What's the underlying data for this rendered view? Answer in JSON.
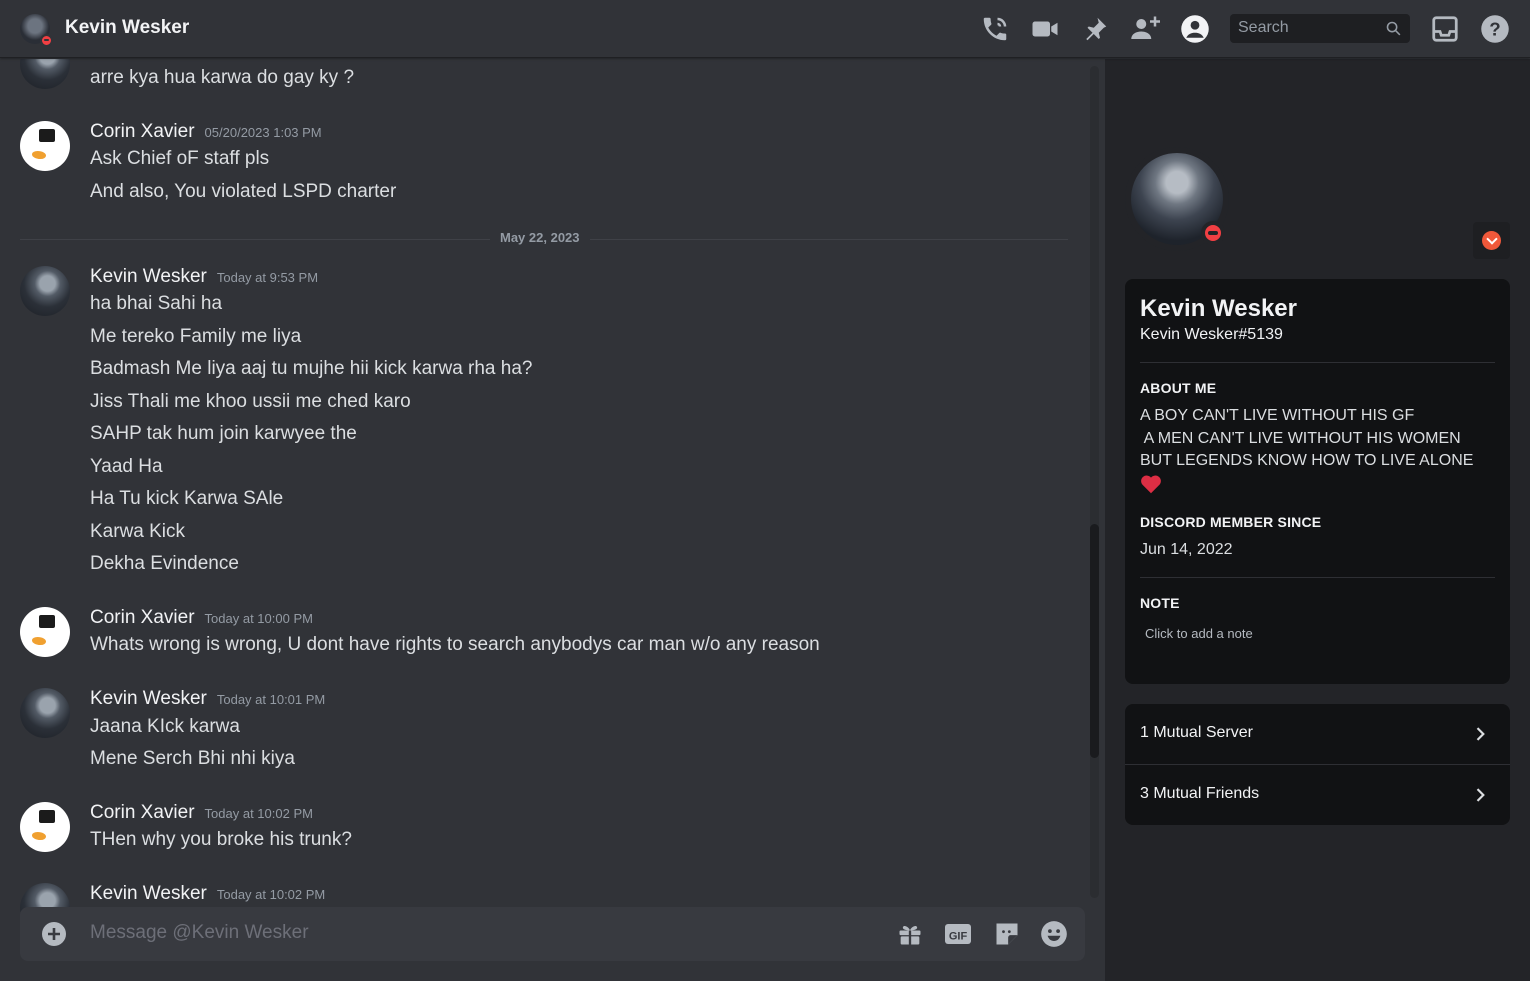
{
  "header": {
    "title": "Kevin Wesker",
    "search_placeholder": "Search",
    "icons": [
      "start-voice-call-icon",
      "start-video-call-icon",
      "pinned-messages-icon",
      "add-friends-to-dm-icon",
      "hide-user-profile-icon",
      "inbox-icon",
      "help-icon"
    ]
  },
  "messages": [
    {
      "author": "",
      "timestamp": "",
      "lines": [
        "arre kya hua karwa do gay ky ?"
      ]
    },
    {
      "author": "Corin Xavier",
      "timestamp": "05/20/2023 1:03 PM",
      "lines": [
        "Ask Chief oF staff pls",
        "And also, You violated LSPD charter"
      ]
    },
    {
      "divider": "May 22, 2023"
    },
    {
      "author": "Kevin Wesker",
      "timestamp": "Today at 9:53 PM",
      "lines": [
        "ha bhai Sahi ha",
        "Me tereko Family me liya",
        "Badmash Me liya aaj tu mujhe hii kick karwa rha ha?",
        "Jiss Thali me khoo ussii me ched karo",
        "SAHP tak hum join karwyee the",
        "Yaad Ha",
        "Ha Tu kick Karwa SAle",
        "Karwa Kick",
        "Dekha Evindence"
      ]
    },
    {
      "author": "Corin Xavier",
      "timestamp": "Today at 10:00 PM",
      "lines": [
        "Whats wrong is wrong, U dont have rights to search anybodys car man w/o any reason"
      ]
    },
    {
      "author": "Kevin Wesker",
      "timestamp": "Today at 10:01 PM",
      "lines": [
        "Jaana KIck karwa",
        "Mene Serch Bhi nhi kiya"
      ]
    },
    {
      "author": "Corin Xavier",
      "timestamp": "Today at 10:02 PM",
      "lines": [
        "THen why you broke his trunk?"
      ]
    },
    {
      "author": "Kevin Wesker",
      "timestamp": "Today at 10:02 PM",
      "lines": []
    }
  ],
  "composer": {
    "placeholder": "Message @Kevin Wesker",
    "icons": [
      "add-attachment-icon",
      "gift-icon",
      "gif-icon",
      "sticker-icon",
      "emoji-icon"
    ],
    "gif_label": "GIF"
  },
  "profile": {
    "display_name": "Kevin Wesker",
    "username": "Kevin Wesker#5139",
    "status": "do-not-disturb",
    "about_heading": "ABOUT ME",
    "about_lines": [
      "A BOY CAN'T LIVE WITHOUT HIS GF",
      " A MEN CAN'T LIVE WITHOUT HIS WOMEN",
      "BUT LEGENDS KNOW HOW TO LIVE ALONE"
    ],
    "about_emoji": "red-heart-icon",
    "member_since_heading": "DISCORD MEMBER SINCE",
    "member_since": "Jun 14, 2022",
    "note_heading": "NOTE",
    "note_placeholder": "Click to add a note",
    "mutual_servers": "1 Mutual Server",
    "mutual_friends": "3 Mutual Friends"
  },
  "colors": {
    "background": "#313338",
    "sidebar": "#232428",
    "card": "#111214",
    "dnd_red": "#f23f43",
    "text": "#dbdee1"
  }
}
